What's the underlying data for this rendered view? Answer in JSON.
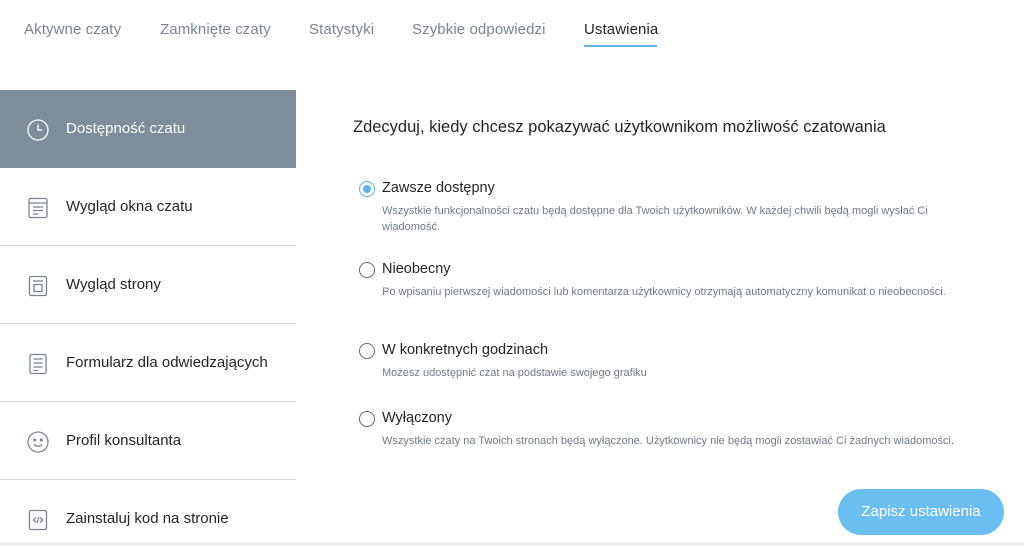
{
  "tabs": [
    {
      "label": "Aktywne czaty"
    },
    {
      "label": "Zamknięte czaty"
    },
    {
      "label": "Statystyki"
    },
    {
      "label": "Szybkie odpowiedzi"
    },
    {
      "label": "Ustawienia",
      "active": true
    }
  ],
  "sidebar": {
    "items": [
      {
        "label": "Dostępność czatu",
        "icon": "clock-icon",
        "active": true
      },
      {
        "label": "Wygląd okna czatu",
        "icon": "chat-window-icon"
      },
      {
        "label": "Wygląd strony",
        "icon": "page-icon"
      },
      {
        "label": "Formularz dla odwiedzających",
        "icon": "form-icon"
      },
      {
        "label": "Profil konsultanta",
        "icon": "smiley-icon"
      },
      {
        "label": "Zainstaluj kod na stronie",
        "icon": "code-icon"
      }
    ]
  },
  "main": {
    "title": "Zdecyduj, kiedy chcesz pokazywać użytkownikom możliwość czatowania",
    "options": [
      {
        "label": "Zawsze dostępny",
        "description": "Wszystkie funkcjonalności czatu będą dostępne dla Twoich użytkowników. W każdej chwili będą mogli wysłać Ci wiadomość.",
        "selected": true
      },
      {
        "label": "Nieobecny",
        "description": "Po wpisaniu pierwszej wiadomości lub komentarza użytkownicy otrzymają automatyczny komunikat o nieobecności.",
        "selected": false
      },
      {
        "label": "W konkretnych godzinach",
        "description": "Możesz udostępnić czat na podstawie swojego grafiku",
        "selected": false
      },
      {
        "label": "Wyłączony",
        "description": "Wszystkie czaty na Twoich stronach będą wyłączone. Użytkownicy nie będą mogli zostawiać Ci żadnych wiadomości.",
        "selected": false
      }
    ],
    "save_label": "Zapisz ustawienia"
  },
  "colors": {
    "accent": "#5bb3e6",
    "button": "#6bbff0",
    "sidebar_active": "#7d8d99"
  }
}
